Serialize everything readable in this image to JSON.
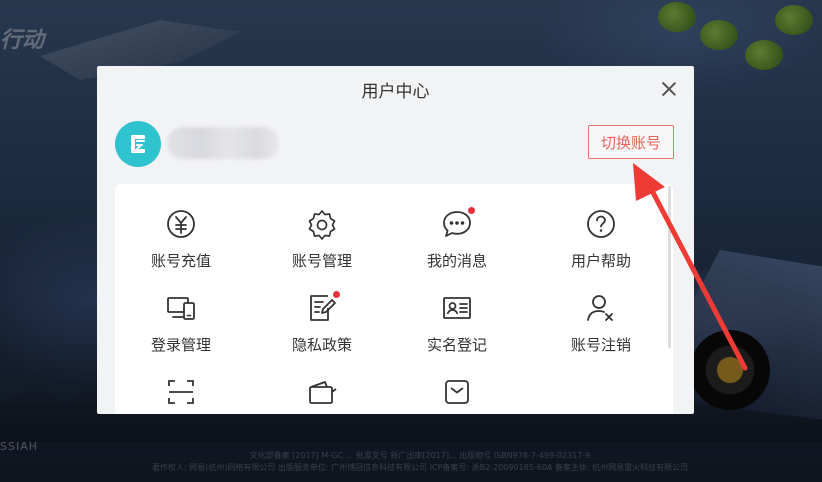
{
  "background": {
    "game_logo_text": "行动",
    "brand_text": "SSIAH",
    "fine_print_1": "文化部备案 [2017] M-GC ... 批准文号 新广出审[2017]... 出版物号 ISBN978-7-498-02317-9",
    "fine_print_2": "著作权人: 网易(杭州)网络有限公司 出版服务单位: 广州博冠信息科技有限公司 ICP备案号: 浙B2-20090185-60A 备案主体: 杭州网易雷火科技有限公司"
  },
  "modal": {
    "title": "用户中心",
    "close_icon": "close-icon",
    "switch_account_label": "切换账号",
    "avatar_color": "#2fc2cf",
    "accent_color": "#e8645c"
  },
  "menu": {
    "items": [
      {
        "label": "账号充值",
        "icon": "yuan-icon",
        "dot": false
      },
      {
        "label": "账号管理",
        "icon": "gear-icon",
        "dot": false
      },
      {
        "label": "我的消息",
        "icon": "message-icon",
        "dot": true
      },
      {
        "label": "用户帮助",
        "icon": "help-icon",
        "dot": false
      },
      {
        "label": "登录管理",
        "icon": "devices-icon",
        "dot": false
      },
      {
        "label": "隐私政策",
        "icon": "privacy-document-icon",
        "dot": true
      },
      {
        "label": "实名登记",
        "icon": "id-card-icon",
        "dot": false
      },
      {
        "label": "账号注销",
        "icon": "user-remove-icon",
        "dot": false
      },
      {
        "label": "",
        "icon": "scan-icon",
        "dot": false
      },
      {
        "label": "",
        "icon": "wallet-icon",
        "dot": false
      },
      {
        "label": "",
        "icon": "inbox-icon",
        "dot": false
      }
    ]
  },
  "annotation": {
    "arrow_color": "#ef3b35"
  }
}
